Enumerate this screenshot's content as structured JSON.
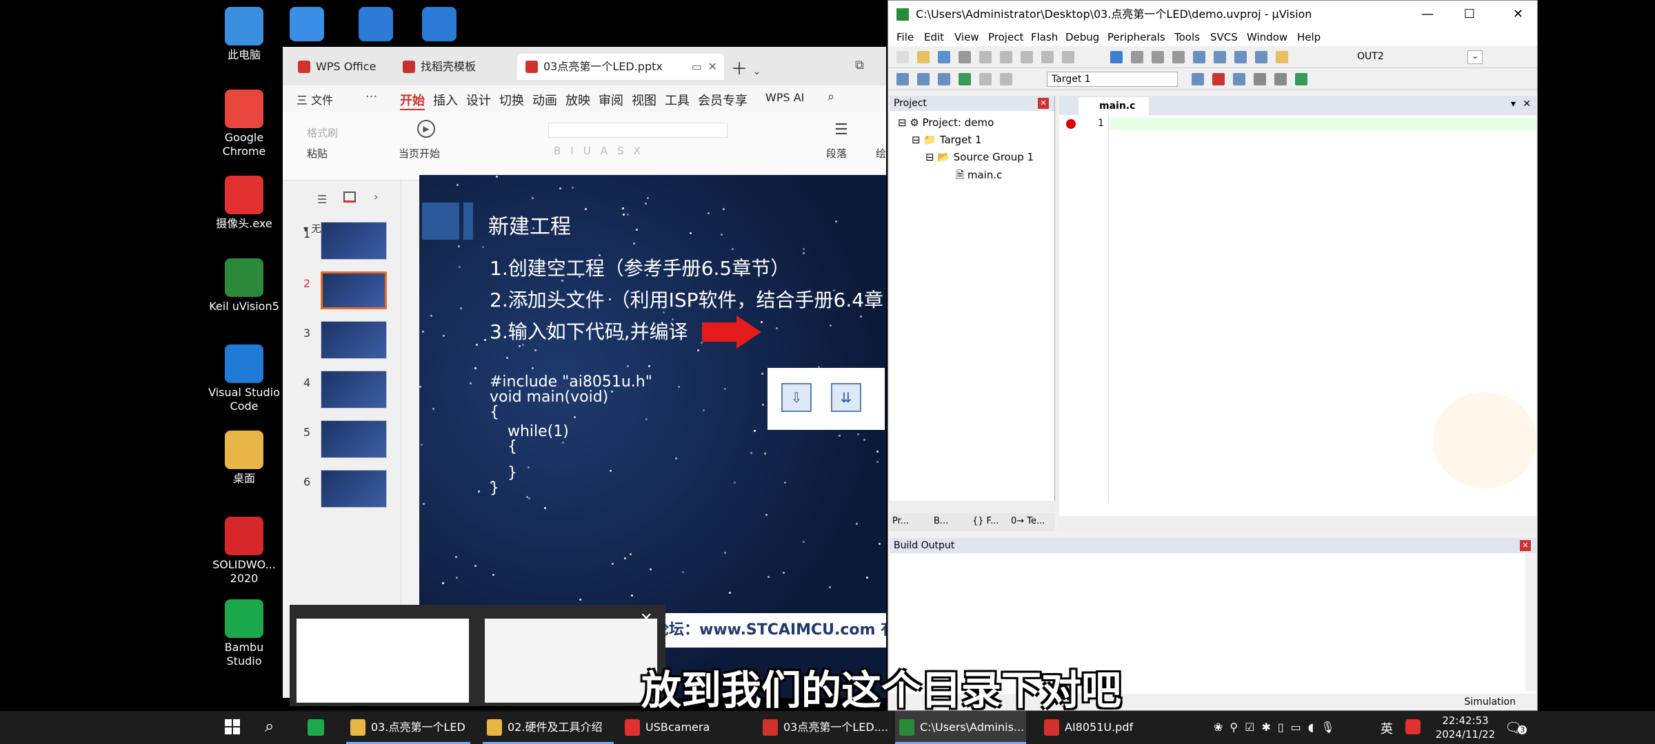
{
  "desktop_icons": [
    {
      "label": "此电脑",
      "icon": "computer-icon",
      "color": "#3b8fe0"
    },
    {
      "label": "Google Chrome",
      "icon": "chrome-icon",
      "color": "#e8453c"
    },
    {
      "label": "摄像头.exe",
      "icon": "camera-app-icon",
      "color": "#e03030"
    },
    {
      "label": "Keil uVision5",
      "icon": "keil-icon",
      "color": "#2a8a3a"
    },
    {
      "label": "Visual Studio Code",
      "icon": "vscode-icon",
      "color": "#1f7bd6"
    },
    {
      "label": "桌面",
      "icon": "folder-icon",
      "color": "#e7b646"
    },
    {
      "label": "SOLIDWO... 2020",
      "icon": "solidworks-icon",
      "color": "#d62828"
    },
    {
      "label": "Bambu Studio",
      "icon": "bambu-icon",
      "color": "#1aa84a"
    }
  ],
  "wps": {
    "tabs": [
      {
        "label": "WPS Office"
      },
      {
        "label": "找稻壳模板"
      },
      {
        "label": "03点亮第一个LED.pptx"
      }
    ],
    "menu": [
      "三 文件",
      "开始",
      "插入",
      "设计",
      "切换",
      "动画",
      "放映",
      "审阅",
      "视图",
      "工具",
      "会员专享",
      "WPS AI"
    ],
    "ribbon": {
      "format_painter": "格式刷",
      "paste": "粘贴",
      "from_current": "当页开始",
      "paragraph": "段落",
      "draw": "绘"
    },
    "section": "无标题节",
    "thumb_numbers": [
      "1",
      "2",
      "3",
      "4",
      "5",
      "6"
    ],
    "slide": {
      "title": "新建工程",
      "lines": [
        "1.创建空工程（参考手册6.5章节）",
        "2.添加头文件 （利用ISP软件，结合手册6.4章",
        "3.输入如下代码,并编译"
      ],
      "code": [
        "#include \"ai8051u.h\"",
        "void main(void)",
        "{",
        "while(1)",
        "{",
        "}",
        "}"
      ],
      "footer": "论坛：www.STCAIMCU.com   有"
    }
  },
  "keil": {
    "title": "C:\\Users\\Administrator\\Desktop\\03.点亮第一个LED\\demo.uvproj - µVision",
    "menu": [
      "File",
      "Edit",
      "View",
      "Project",
      "Flash",
      "Debug",
      "Peripherals",
      "Tools",
      "SVCS",
      "Window",
      "Help"
    ],
    "toolbar_target": "OUT2",
    "target_select": "Target 1",
    "project_pane": "Project",
    "tree": [
      "Project: demo",
      "Target 1",
      "Source Group 1",
      "main.c"
    ],
    "pane_tabs": [
      "Pr...",
      "B...",
      "{} F...",
      "0→ Te..."
    ],
    "editor_tab": "main.c",
    "line_number": "1",
    "build_output": "Build Output",
    "status": "Simulation"
  },
  "subtitle": "放到我们的这个目录下对吧",
  "taskbar": {
    "items": [
      {
        "label": "03.点亮第一个LED",
        "color": "#e7b646"
      },
      {
        "label": "02.硬件及工具介绍",
        "color": "#e7b646"
      },
      {
        "label": "USBcamera",
        "color": "#e03030"
      },
      {
        "label": "03点亮第一个LED....",
        "color": "#d3312b"
      },
      {
        "label": "C:\\Users\\Adminis...",
        "color": "#2a8a3a"
      },
      {
        "label": "AI8051U.pdf",
        "color": "#d3312b"
      }
    ],
    "ime": "英",
    "time": "22:42:53",
    "date": "2024/11/22",
    "notifications": "3"
  }
}
